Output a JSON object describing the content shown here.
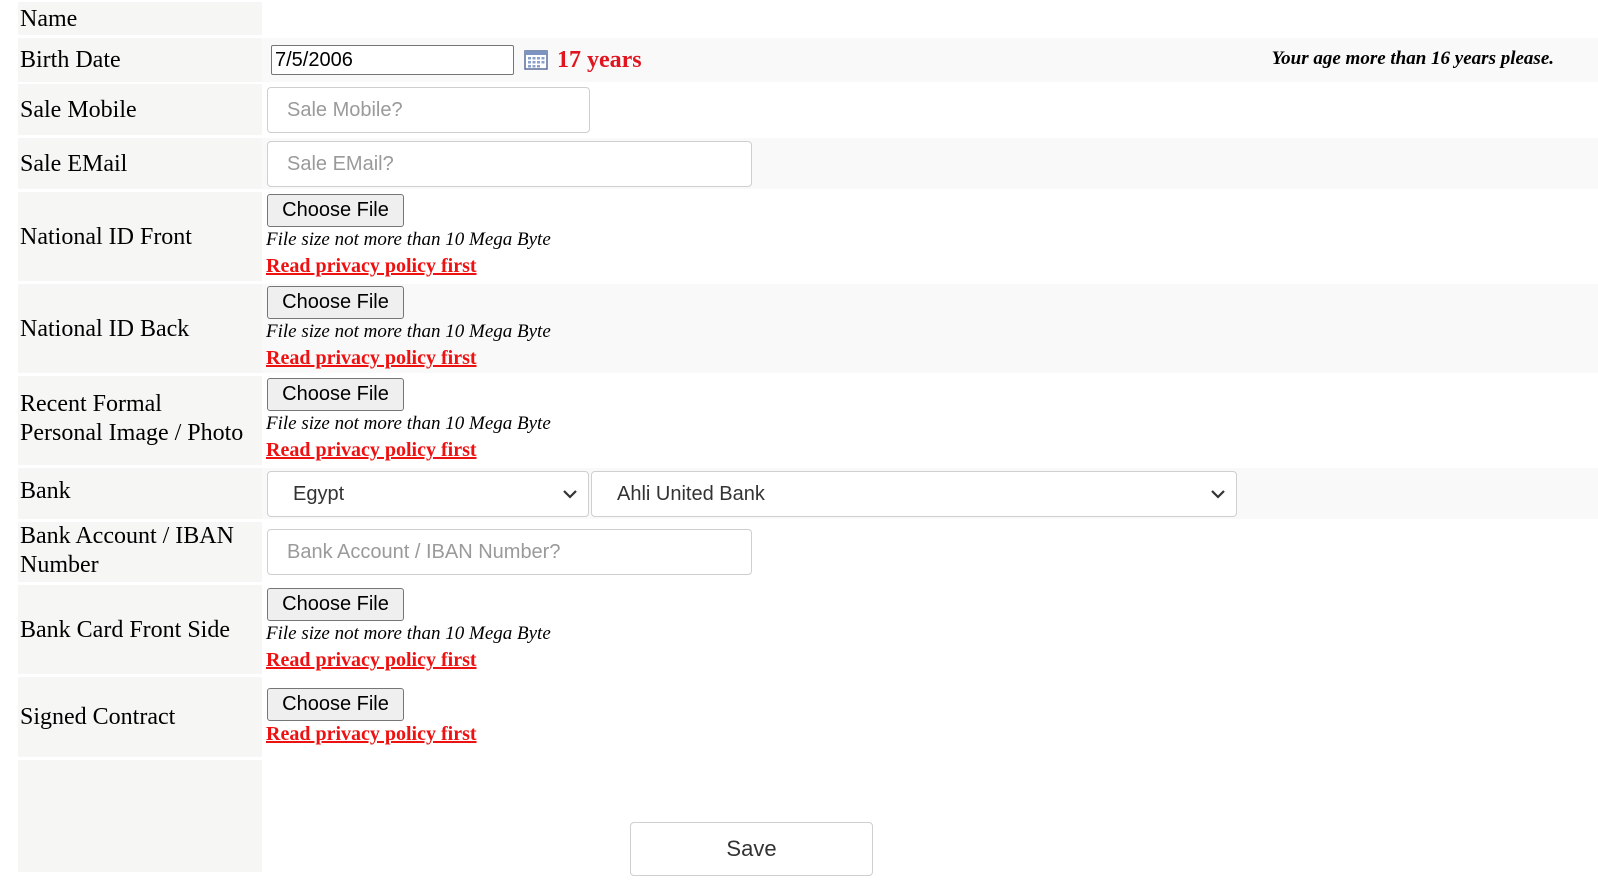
{
  "labels": {
    "name": "Name",
    "birth_date": "Birth Date",
    "sale_mobile": "Sale Mobile",
    "sale_email": "Sale EMail",
    "national_id_front": "National ID Front",
    "national_id_back": "National ID Back",
    "recent_photo_line1": "Recent Formal",
    "recent_photo_line2": "Personal Image / Photo",
    "bank": "Bank",
    "bank_account_line1": "Bank Account / IBAN",
    "bank_account_line2": "Number",
    "bank_card_front": "Bank Card Front Side",
    "signed_contract": "Signed Contract"
  },
  "birth_date": {
    "value": "7/5/2006",
    "age": "17 years",
    "note": "Your age more than 16 years please."
  },
  "sale_mobile": {
    "placeholder": "Sale Mobile?"
  },
  "sale_email": {
    "placeholder": "Sale EMail?"
  },
  "bank_account": {
    "placeholder": "Bank Account / IBAN Number?"
  },
  "file": {
    "button_label": "Choose File",
    "size_note": "File size not more than 10 Mega Byte",
    "privacy_link": "Read privacy policy first"
  },
  "bank": {
    "country": "Egypt",
    "bank_name": "Ahli United Bank"
  },
  "save_label": "Save",
  "colors": {
    "label_bg": "#f6f6f4",
    "age_red": "#e0151f",
    "link_red": "#ee1111"
  }
}
